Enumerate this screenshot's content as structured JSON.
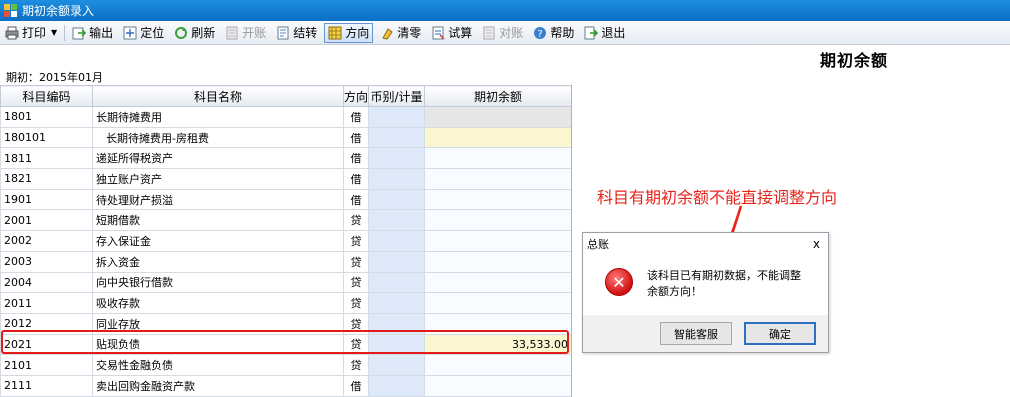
{
  "window": {
    "title": "期初余额录入"
  },
  "toolbar": {
    "items": [
      {
        "label": "打印",
        "icon": "printer-icon"
      },
      {
        "label": "输出",
        "icon": "export-icon"
      },
      {
        "label": "定位",
        "icon": "locate-icon"
      },
      {
        "label": "刷新",
        "icon": "refresh-icon"
      },
      {
        "label": "开账",
        "icon": "open-ledger-icon",
        "disabled": true
      },
      {
        "label": "结转",
        "icon": "carry-forward-icon"
      },
      {
        "label": "方向",
        "icon": "direction-icon",
        "active": true
      },
      {
        "label": "清零",
        "icon": "clear-icon"
      },
      {
        "label": "试算",
        "icon": "trial-balance-icon"
      },
      {
        "label": "对账",
        "icon": "reconcile-icon",
        "disabled": true
      },
      {
        "label": "帮助",
        "icon": "help-icon"
      },
      {
        "label": "退出",
        "icon": "exit-icon"
      }
    ]
  },
  "page": {
    "heading": "期初余额",
    "period": "期初：2015年01月"
  },
  "table": {
    "columns": [
      "科目编码",
      "科目名称",
      "方向",
      "币别/计量",
      "期初余额"
    ],
    "rows": [
      {
        "code": "1801",
        "name": "长期待摊费用",
        "dir": "借",
        "bal": "",
        "bal_style": "grey"
      },
      {
        "code": "180101",
        "name": "长期待摊费用-房租费",
        "dir": "借",
        "bal": "",
        "bal_style": "yellow",
        "sub": true
      },
      {
        "code": "1811",
        "name": "递延所得税资产",
        "dir": "借",
        "bal": "",
        "bal_style": "light"
      },
      {
        "code": "1821",
        "name": "独立账户资产",
        "dir": "借",
        "bal": "",
        "bal_style": "light"
      },
      {
        "code": "1901",
        "name": "待处理财产损溢",
        "dir": "借",
        "bal": "",
        "bal_style": "light"
      },
      {
        "code": "2001",
        "name": "短期借款",
        "dir": "贷",
        "bal": "",
        "bal_style": "light"
      },
      {
        "code": "2002",
        "name": "存入保证金",
        "dir": "贷",
        "bal": "",
        "bal_style": "light"
      },
      {
        "code": "2003",
        "name": "拆入资金",
        "dir": "贷",
        "bal": "",
        "bal_style": "light"
      },
      {
        "code": "2004",
        "name": "向中央银行借款",
        "dir": "贷",
        "bal": "",
        "bal_style": "light"
      },
      {
        "code": "2011",
        "name": "吸收存款",
        "dir": "贷",
        "bal": "",
        "bal_style": "light"
      },
      {
        "code": "2012",
        "name": "同业存放",
        "dir": "贷",
        "bal": "",
        "bal_style": "light"
      },
      {
        "code": "2021",
        "name": "贴现负债",
        "dir": "贷",
        "bal": "33,533.00",
        "bal_style": "yellow"
      },
      {
        "code": "2101",
        "name": "交易性金融负债",
        "dir": "贷",
        "bal": "",
        "bal_style": "light"
      },
      {
        "code": "2111",
        "name": "卖出回购金融资产款",
        "dir": "借",
        "bal": "",
        "bal_style": "light"
      }
    ]
  },
  "annotation": {
    "text": "科目有期初余额不能直接调整方向",
    "color": "#e8231b"
  },
  "dialog": {
    "title": "总账",
    "close": "x",
    "message": "该科目已有期初数据，不能调整余额方向！",
    "buttons": {
      "service": "智能客服",
      "ok": "确定"
    }
  },
  "colors": {
    "titlebar": "#0a6fc4",
    "highlight": "#e21a1a"
  }
}
